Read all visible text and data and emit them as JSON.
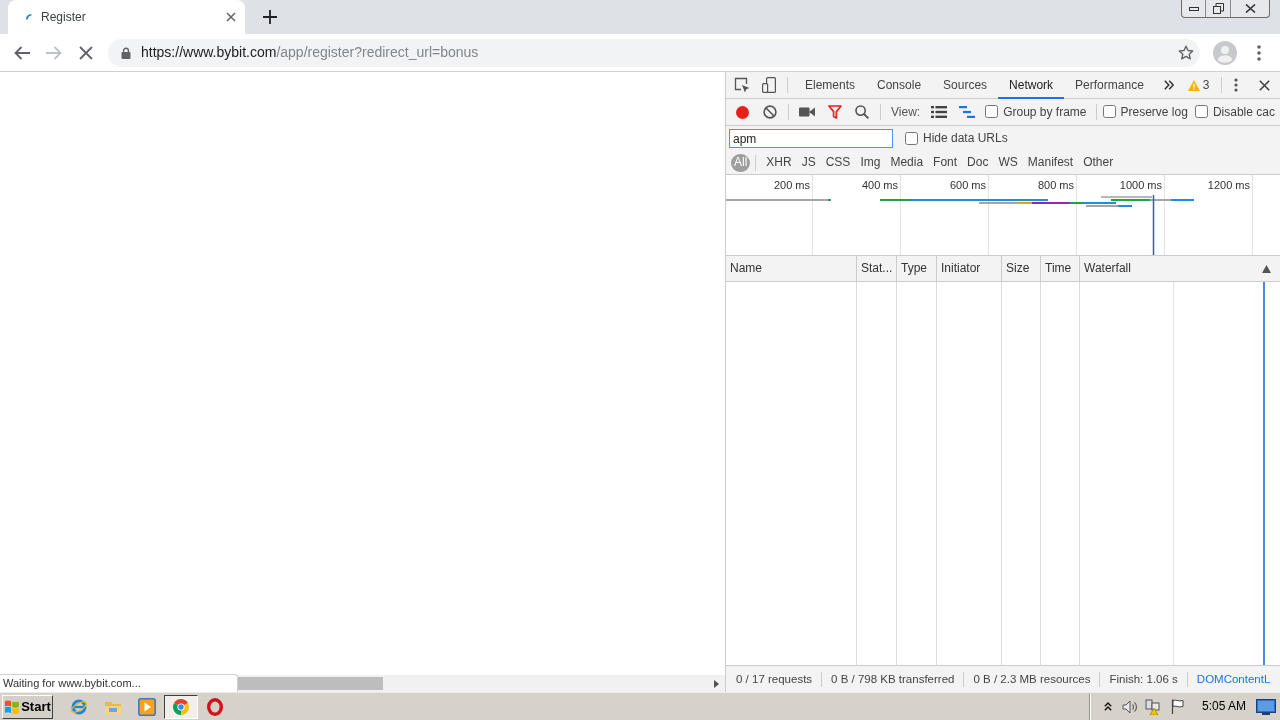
{
  "browser_tabs": [
    {
      "title": "Register",
      "selected": true
    }
  ],
  "address_bar": {
    "host": "https://www.bybit.com",
    "path": "/app/register?redirect_url=bonus"
  },
  "page": {
    "status_text": "Waiting for www.bybit.com..."
  },
  "devtools": {
    "panel_tabs": [
      {
        "label": "Elements",
        "selected": false
      },
      {
        "label": "Console",
        "selected": false
      },
      {
        "label": "Sources",
        "selected": false
      },
      {
        "label": "Network",
        "selected": true
      },
      {
        "label": "Performance",
        "selected": false
      }
    ],
    "warning_count": "3",
    "network_toolbar": {
      "recording": true,
      "filter_bar_open": true,
      "view_label": "View:",
      "view_modes": [
        {
          "kind": "rows",
          "selected": false
        },
        {
          "kind": "overview",
          "selected": true
        }
      ],
      "options": [
        {
          "label": "Group by frame",
          "checked": false
        },
        {
          "label": "Preserve log",
          "checked": false
        },
        {
          "label": "Disable cac",
          "checked": false
        }
      ]
    },
    "filter": {
      "value": "apm",
      "options": [
        {
          "label": "Hide data URLs",
          "checked": false
        }
      ]
    },
    "type_filters": [
      {
        "label": "All",
        "selected": true
      },
      {
        "label": "XHR",
        "selected": false
      },
      {
        "label": "JS",
        "selected": false
      },
      {
        "label": "CSS",
        "selected": false
      },
      {
        "label": "Img",
        "selected": false
      },
      {
        "label": "Media",
        "selected": false
      },
      {
        "label": "Font",
        "selected": false
      },
      {
        "label": "Doc",
        "selected": false
      },
      {
        "label": "WS",
        "selected": false
      },
      {
        "label": "Manifest",
        "selected": false
      },
      {
        "label": "Other",
        "selected": false
      }
    ],
    "overview": {
      "ticks": [
        "200 ms",
        "400 ms",
        "600 ms",
        "800 ms",
        "1000 ms",
        "1200 ms"
      ]
    },
    "table": {
      "columns": [
        "Name",
        "Stat...",
        "Type",
        "Initiator",
        "Size",
        "Time",
        "Waterfall"
      ]
    },
    "summary": [
      {
        "kind": "stat",
        "text": "0 / 17 requests"
      },
      {
        "kind": "stat",
        "text": "0 B / 798 KB transferred"
      },
      {
        "kind": "stat",
        "text": "0 B / 2.3 MB resources"
      },
      {
        "kind": "stat",
        "text": "Finish: 1.06 s"
      },
      {
        "kind": "event",
        "text": "DOMContentL"
      }
    ]
  },
  "taskbar": {
    "start_label": "Start",
    "apps": [
      {
        "kind": "ie",
        "active": false
      },
      {
        "kind": "explorer",
        "active": false
      },
      {
        "kind": "media",
        "active": false
      },
      {
        "kind": "chrome",
        "active": true
      },
      {
        "kind": "opera",
        "active": false
      }
    ],
    "clock": "5:05 AM"
  }
}
